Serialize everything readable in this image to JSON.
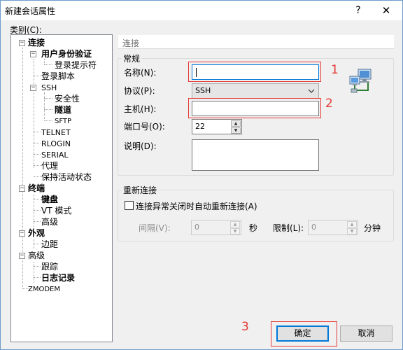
{
  "window": {
    "title": "新建会话属性",
    "help_label": "?",
    "close_label": "✕"
  },
  "category_label": "类别(C):",
  "tree": {
    "items": [
      {
        "label": "连接",
        "bold": true
      },
      {
        "label": "用户身份验证",
        "bold": true
      },
      {
        "label": "登录提示符",
        "bold": false
      },
      {
        "label": "登录脚本",
        "bold": false
      },
      {
        "label": "SSH",
        "bold": false
      },
      {
        "label": "安全性",
        "bold": false
      },
      {
        "label": "隧道",
        "bold": true
      },
      {
        "label": "SFTP",
        "bold": false
      },
      {
        "label": "TELNET",
        "bold": false
      },
      {
        "label": "RLOGIN",
        "bold": false
      },
      {
        "label": "SERIAL",
        "bold": false
      },
      {
        "label": "代理",
        "bold": false
      },
      {
        "label": "保持活动状态",
        "bold": false
      },
      {
        "label": "终端",
        "bold": true
      },
      {
        "label": "键盘",
        "bold": true
      },
      {
        "label": "VT 模式",
        "bold": false
      },
      {
        "label": "高级",
        "bold": false
      },
      {
        "label": "外观",
        "bold": true
      },
      {
        "label": "边距",
        "bold": false
      },
      {
        "label": "高级",
        "bold": false
      },
      {
        "label": "跟踪",
        "bold": false
      },
      {
        "label": "日志记录",
        "bold": true
      },
      {
        "label": "ZMODEM",
        "bold": false
      }
    ],
    "expander": "−"
  },
  "panel": {
    "header": "连接",
    "general": {
      "title": "常规",
      "name_label": "名称(N):",
      "name_value": "",
      "protocol_label": "协议(P):",
      "protocol_value": "SSH",
      "host_label": "主机(H):",
      "host_value": "",
      "port_label": "端口号(O):",
      "port_value": "22",
      "desc_label": "说明(D):",
      "desc_value": ""
    },
    "reconnect": {
      "title": "重新连接",
      "checkbox_label": "连接异常关闭时自动重新连接(A)",
      "checked": false,
      "interval_label": "间隔(V):",
      "interval_value": "0",
      "interval_unit": "秒",
      "limit_label": "限制(L):",
      "limit_value": "0",
      "limit_unit": "分钟"
    }
  },
  "annotations": [
    "1",
    "2",
    "3"
  ],
  "buttons": {
    "ok": "确定",
    "cancel": "取消"
  },
  "icons": {
    "network": "network-computer-icon",
    "chevron": "chevron-down-icon"
  },
  "colors": {
    "accent": "#0078d7",
    "annotation": "#e53935"
  }
}
